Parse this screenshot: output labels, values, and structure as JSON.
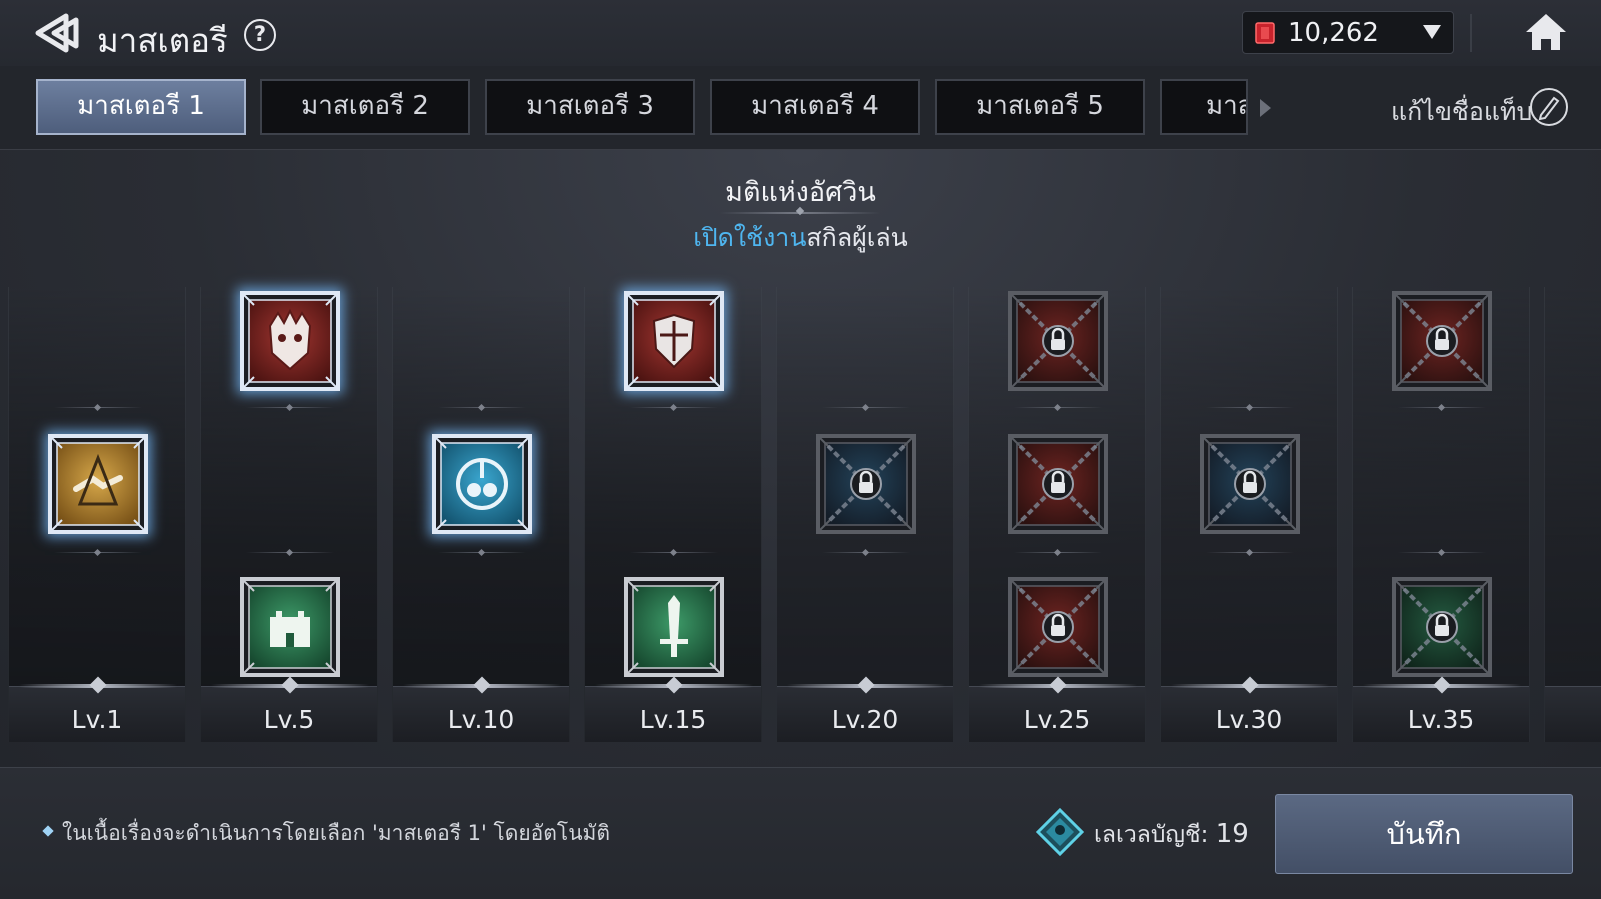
{
  "header": {
    "title": "มาสเตอรี",
    "help_label": "?",
    "currency_value": "10,262",
    "back_icon": "back-arrow-icon",
    "home_icon": "home-icon",
    "currency_icon": "red-gem-icon"
  },
  "tabs": [
    {
      "label": "มาสเตอรี 1",
      "active": true
    },
    {
      "label": "มาสเตอรี 2",
      "active": false
    },
    {
      "label": "มาสเตอรี 3",
      "active": false
    },
    {
      "label": "มาสเตอรี 4",
      "active": false
    },
    {
      "label": "มาสเตอรี 5",
      "active": false
    },
    {
      "label": "มาส",
      "active": false
    }
  ],
  "rename_label": "แก้ไขชื่อแท็บ",
  "section": {
    "title": "มติแห่งอัศวิน",
    "subtitle_highlight": "เปิดใช้งาน",
    "subtitle_rest": "สกิลผู้เล่น"
  },
  "levels": [
    {
      "label": "Lv.1",
      "skills": [
        {
          "row": "middle",
          "color": "gold",
          "state": "selected",
          "icon": "handshake-icon"
        }
      ]
    },
    {
      "label": "Lv.5",
      "skills": [
        {
          "row": "top",
          "color": "red",
          "state": "selected",
          "icon": "demon-mask-icon"
        },
        {
          "row": "bottom",
          "color": "green",
          "state": "available",
          "icon": "castle-icon"
        }
      ]
    },
    {
      "label": "Lv.10",
      "skills": [
        {
          "row": "middle",
          "color": "blue",
          "state": "selected",
          "icon": "potion-icon"
        }
      ]
    },
    {
      "label": "Lv.15",
      "skills": [
        {
          "row": "top",
          "color": "red",
          "state": "selected",
          "icon": "shield-icon"
        },
        {
          "row": "bottom",
          "color": "green",
          "state": "available",
          "icon": "sword-icon"
        }
      ]
    },
    {
      "label": "Lv.20",
      "skills": [
        {
          "row": "middle",
          "color": "blue",
          "state": "locked",
          "icon": "lock-icon"
        }
      ]
    },
    {
      "label": "Lv.25",
      "skills": [
        {
          "row": "top",
          "color": "red",
          "state": "locked",
          "icon": "lock-icon"
        },
        {
          "row": "middle",
          "color": "red",
          "state": "locked",
          "icon": "lock-icon"
        },
        {
          "row": "bottom",
          "color": "red",
          "state": "locked",
          "icon": "lock-icon"
        }
      ]
    },
    {
      "label": "Lv.30",
      "skills": [
        {
          "row": "middle",
          "color": "blue",
          "state": "locked",
          "icon": "lock-icon"
        }
      ]
    },
    {
      "label": "Lv.35",
      "skills": [
        {
          "row": "top",
          "color": "red",
          "state": "locked",
          "icon": "lock-icon"
        },
        {
          "row": "bottom",
          "color": "green",
          "state": "locked",
          "icon": "lock-icon"
        }
      ]
    }
  ],
  "footer": {
    "notice": "ในเนื้อเรื่องจะดำเนินการโดยเลือก 'มาสเตอรี 1' โดยอัตโนมัติ",
    "account_level_label": "เลเวลบัญชี:",
    "account_level_value": "19",
    "save_label": "บันทึก",
    "account_icon": "account-level-icon"
  },
  "colors": {
    "gold": "#b8862e",
    "red": "#8c2a26",
    "blue": "#2b83a8",
    "green": "#2d7a52",
    "highlight": "#4fb6f0"
  }
}
